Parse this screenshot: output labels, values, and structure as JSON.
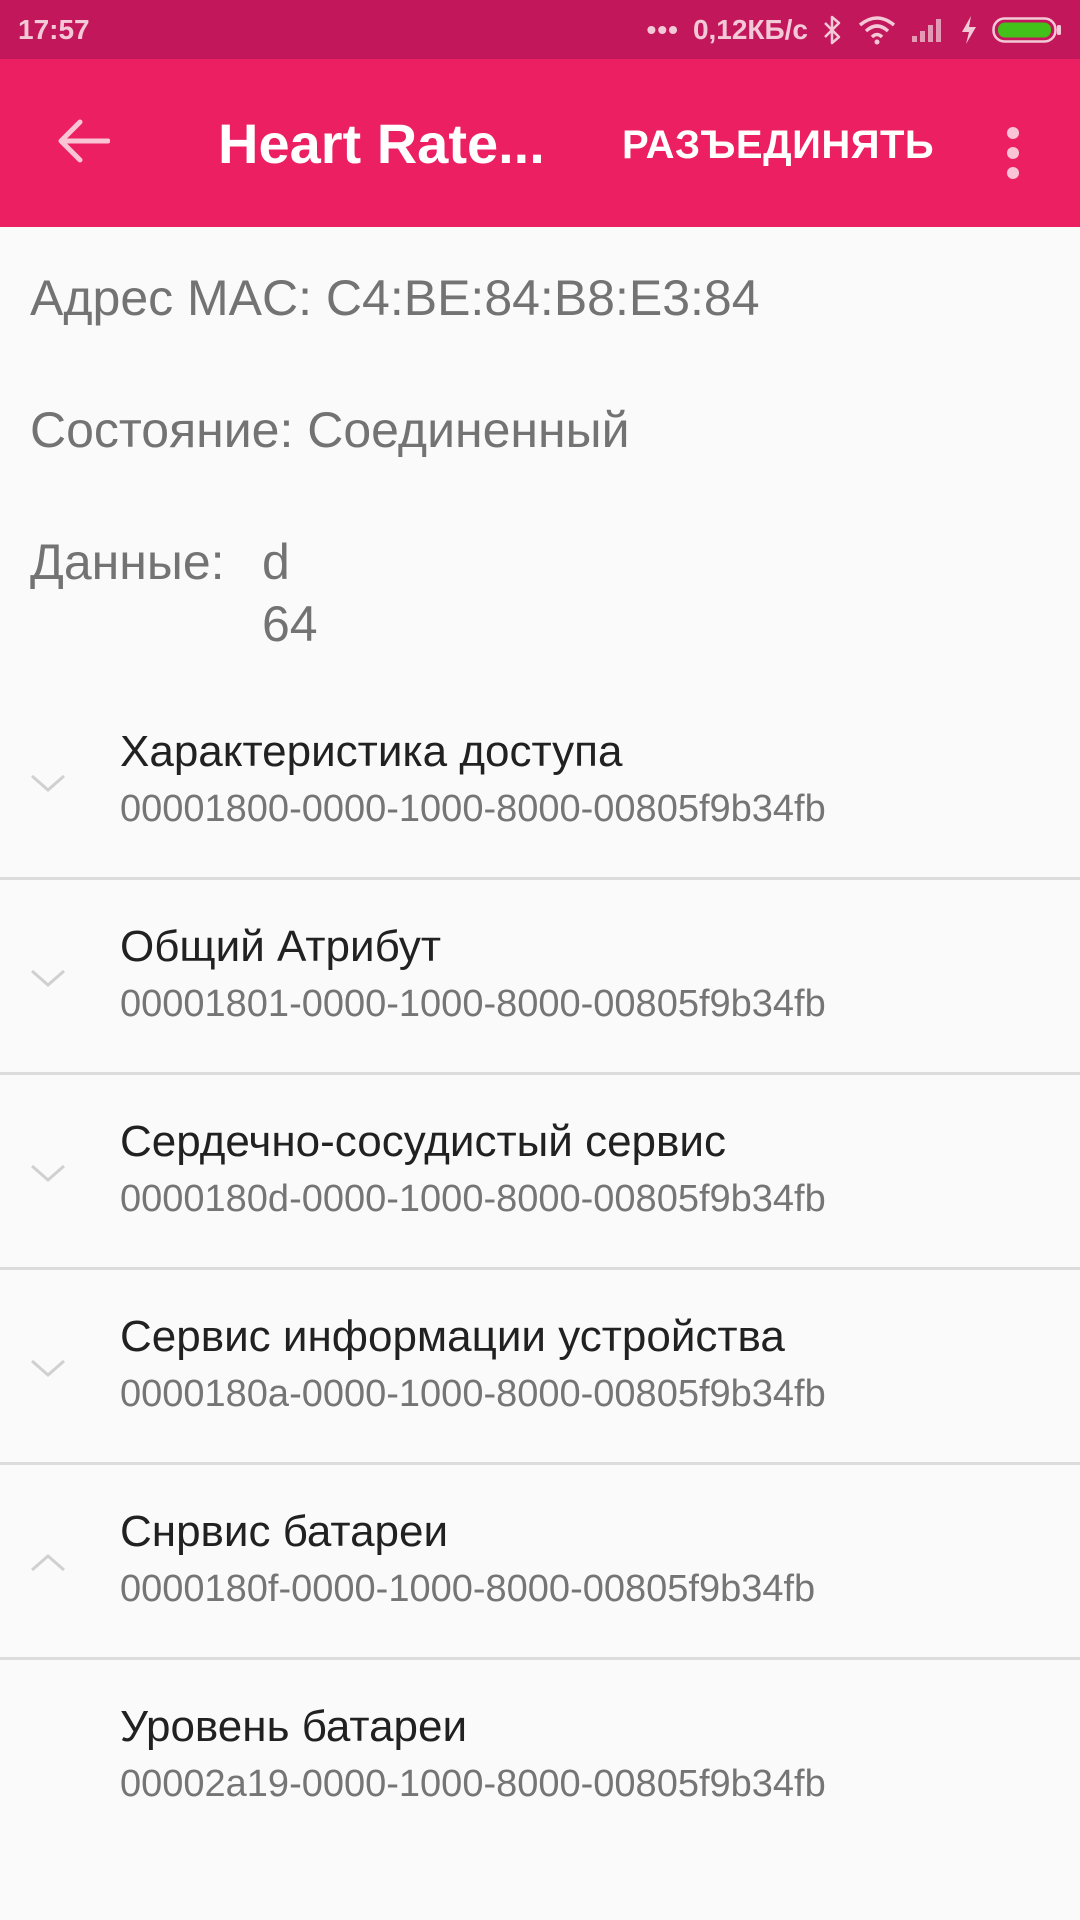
{
  "status_bar": {
    "time": "17:57",
    "dots": "•••",
    "network_speed": "0,12КБ/с",
    "icons": [
      "bluetooth-icon",
      "wifi-icon",
      "signal-icon",
      "charging-icon",
      "battery-icon"
    ],
    "battery_color": "#43c11b"
  },
  "app_bar": {
    "title": "Heart Rate...",
    "disconnect_label": "РАЗЪЕДИНЯТЬ",
    "back_icon": "arrow-left-icon",
    "menu_icon": "more-vert-icon",
    "color": "#ec1f63"
  },
  "device": {
    "mac_line": "Адрес MAC: C4:BE:84:B8:E3:84",
    "state_line": "Состояние: Соединенный",
    "data_label": "Данные:",
    "data_values": [
      "d",
      "64"
    ]
  },
  "services": [
    {
      "name": "Характеристика доступа",
      "uuid": "00001800-0000-1000-8000-00805f9b34fb",
      "expanded": false
    },
    {
      "name": "Общий Атрибут",
      "uuid": "00001801-0000-1000-8000-00805f9b34fb",
      "expanded": false
    },
    {
      "name": "Сердечно-сосудистый сервис",
      "uuid": "0000180d-0000-1000-8000-00805f9b34fb",
      "expanded": false
    },
    {
      "name": "Сервис информации устройства",
      "uuid": "0000180a-0000-1000-8000-00805f9b34fb",
      "expanded": false
    },
    {
      "name": "Снрвис батареи",
      "uuid": "0000180f-0000-1000-8000-00805f9b34fb",
      "expanded": true
    }
  ],
  "characteristic": {
    "name": "Уровень батареи",
    "uuid": "00002a19-0000-1000-8000-00805f9b34fb"
  }
}
